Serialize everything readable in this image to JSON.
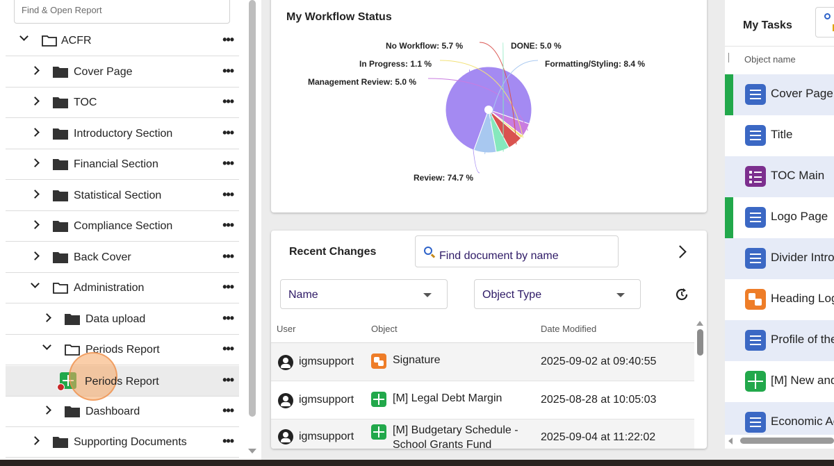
{
  "sidebar": {
    "search_placeholder": "Find & Open Report",
    "root": "ACFR",
    "items": [
      {
        "label": "Cover Page"
      },
      {
        "label": "TOC"
      },
      {
        "label": "Introductory Section"
      },
      {
        "label": "Financial Section"
      },
      {
        "label": "Statistical Section"
      },
      {
        "label": "Compliance Section"
      },
      {
        "label": "Back Cover"
      },
      {
        "label": "Administration"
      },
      {
        "label": "Data upload"
      },
      {
        "label": "Periods Report"
      },
      {
        "label": "Periods Report"
      },
      {
        "label": "Dashboard"
      },
      {
        "label": "Supporting Documents"
      }
    ],
    "more": "•••"
  },
  "workflow": {
    "title": "My Workflow Status",
    "chart_data": {
      "type": "pie",
      "title": "My Workflow Status",
      "slices": [
        {
          "label": "Review",
          "value": 74.7,
          "color": "#a48af2"
        },
        {
          "label": "Management Review",
          "value": 5.0,
          "color": "#c97ce0"
        },
        {
          "label": "In Progress",
          "value": 1.1,
          "color": "#f2e27a"
        },
        {
          "label": "No Workflow",
          "value": 5.7,
          "color": "#d9534f"
        },
        {
          "label": "DONE",
          "value": 5.0,
          "color": "#86e8bd"
        },
        {
          "label": "Formatting/Styling",
          "value": 8.4,
          "color": "#a8c8f0"
        }
      ],
      "labels": [
        "No Workflow: 5.7 %",
        "DONE: 5.0 %",
        "In Progress: 1.1 %",
        "Formatting/Styling: 8.4 %",
        "Management Review: 5.0 %",
        "Review: 74.7 %"
      ]
    }
  },
  "recent": {
    "title": "Recent Changes",
    "search_placeholder": "Find document by name",
    "filter_name": "Name",
    "filter_type": "Object Type",
    "col_user": "User",
    "col_object": "Object",
    "col_date": "Date Modified",
    "rows": [
      {
        "user": "igmsupport",
        "object": "Signature",
        "date": "2025-09-02 at 09:40:55",
        "icon_color": "#ee7d28"
      },
      {
        "user": "igmsupport",
        "object": "[M] Legal Debt Margin",
        "date": "2025-08-28 at 10:05:03",
        "icon_color": "#22a84b"
      },
      {
        "user": "igmsupport",
        "object": "[M] Budgetary Schedule - School Grants Fund",
        "date": "2025-09-04 at 11:22:02",
        "icon_color": "#22a84b"
      }
    ]
  },
  "tasks": {
    "title": "My Tasks",
    "col_object": "Object name",
    "items": [
      {
        "name": "Cover Page",
        "icon_color": "#3b68c4"
      },
      {
        "name": "Title",
        "icon_color": "#3b68c4"
      },
      {
        "name": "TOC Main",
        "icon_color": "#7c2f8e"
      },
      {
        "name": "Logo Page",
        "icon_color": "#3b68c4"
      },
      {
        "name": "Divider Intro",
        "icon_color": "#3b68c4"
      },
      {
        "name": "Heading Log",
        "icon_color": "#ee7d28"
      },
      {
        "name": "Profile of the",
        "icon_color": "#3b68c4"
      },
      {
        "name": "[M] New and",
        "icon_color": "#22a84b"
      },
      {
        "name": "Economic Ac",
        "icon_color": "#3b68c4"
      }
    ]
  }
}
